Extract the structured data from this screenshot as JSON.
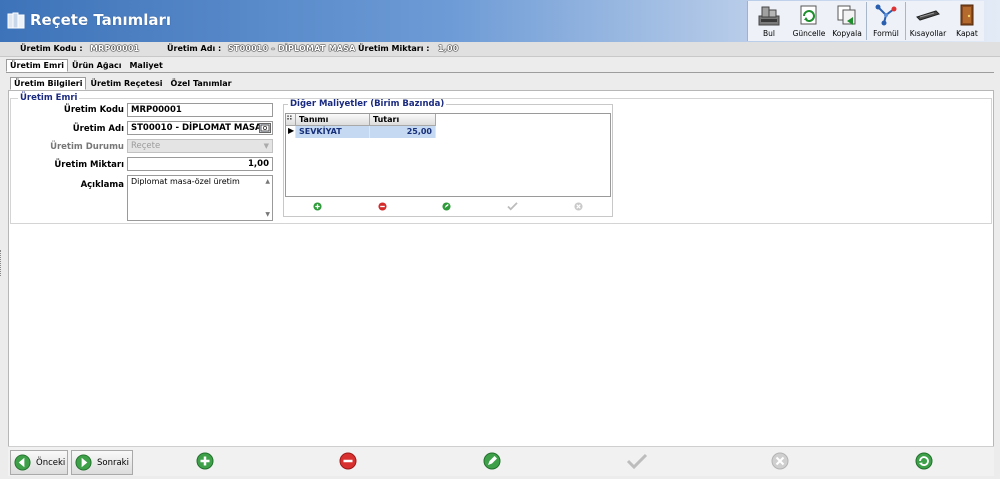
{
  "window": {
    "title": "Reçete Tanımları"
  },
  "toolbar": {
    "bul": "Bul",
    "guncelle": "Güncelle",
    "kopyala": "Kopyala",
    "formul": "Formül",
    "kisayollar": "Kısayollar",
    "kapat": "Kapat"
  },
  "info": {
    "kod_label": "Üretim Kodu  :",
    "kod_value": "MRP00001",
    "adi_label": "Üretim Adı  :",
    "adi_value": "ST00010 - DİPLOMAT MASA",
    "miktar_label": "Üretim Miktarı  :",
    "miktar_value": "1,00"
  },
  "tabs_main": [
    "Üretim Emri",
    "Ürün Ağacı",
    "Maliyet"
  ],
  "tabs_sub": [
    "Üretim Bilgileri",
    "Üretim Reçetesi",
    "Özel Tanımlar"
  ],
  "form": {
    "group_title": "Üretim Emri",
    "kod_label": "Üretim Kodu",
    "kod_value": "MRP00001",
    "adi_label": "Üretim Adı",
    "adi_value": "ST00010 - DİPLOMAT MASA",
    "durum_label": "Üretim Durumu",
    "durum_value": "Reçete",
    "miktar_label": "Üretim Miktarı",
    "miktar_value": "1,00",
    "aciklama_label": "Açıklama",
    "aciklama_value": "Diplomat masa-özel üretim"
  },
  "maliyet": {
    "title": "Diğer Maliyetler (Birim Bazında)",
    "columns": [
      "Tanımı",
      "Tutarı"
    ],
    "rows": [
      {
        "tanimi": "SEVKİYAT",
        "tutari": "25,00"
      }
    ]
  },
  "nav": {
    "prev": "Önceki",
    "next": "Sonraki"
  },
  "colors": {
    "accent": "#3d73b9",
    "selection": "#c6d9f2",
    "group_title": "#1a2a80"
  }
}
